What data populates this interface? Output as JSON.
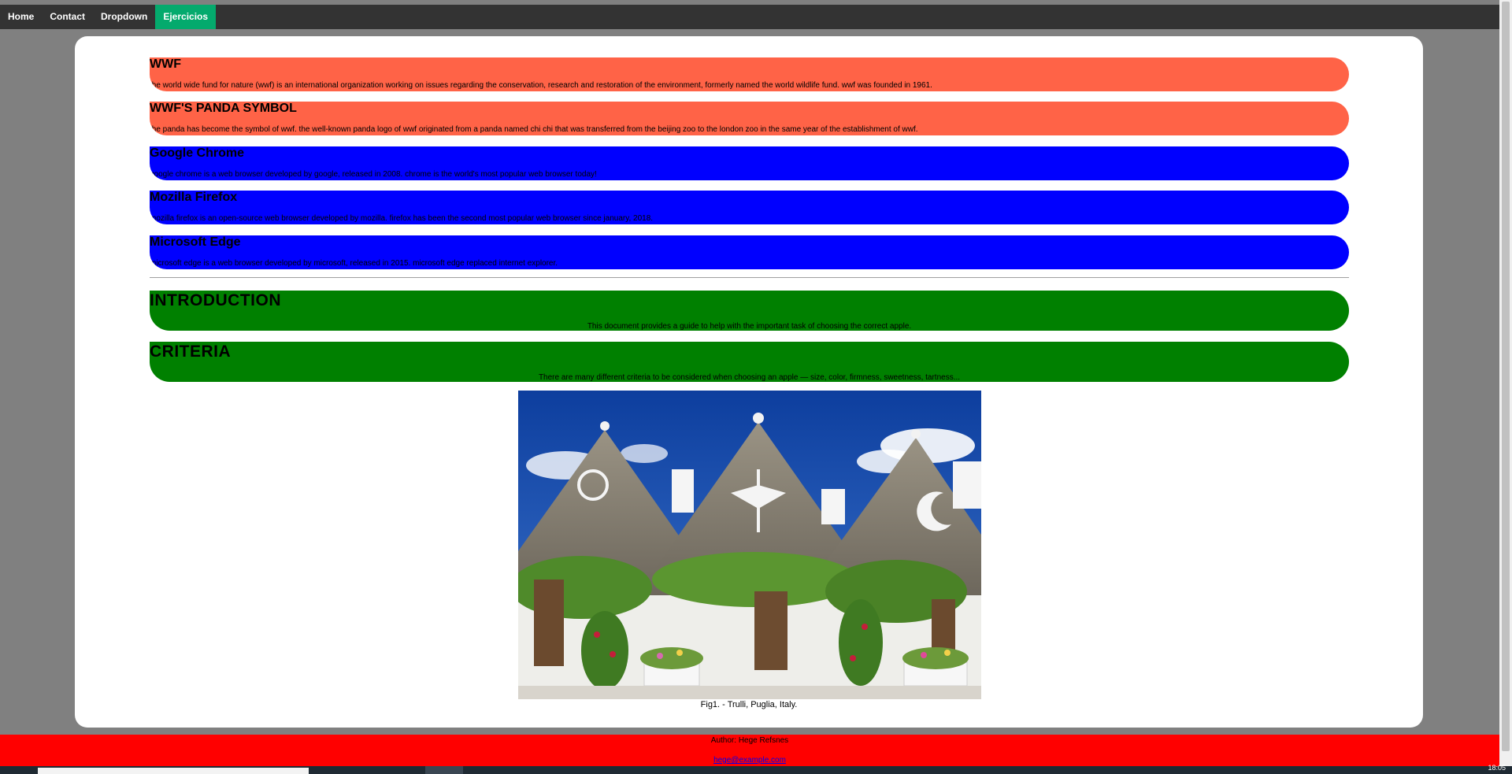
{
  "nav": {
    "items": [
      "Home",
      "Contact",
      "Dropdown",
      "Ejercicios"
    ],
    "active_index": 3,
    "colors": {
      "bar": "#333333",
      "active": "#04aa6d"
    }
  },
  "cards": [
    {
      "title": "WWF",
      "text": "the world wide fund for nature (wwf) is an international organization working on issues regarding the conservation, research and restoration of the environment, formerly named the world wildlife fund. wwf was founded in 1961.",
      "color": "#ff6347"
    },
    {
      "title": "WWF'S PANDA SYMBOL",
      "text": "the panda has become the symbol of wwf. the well-known panda logo of wwf originated from a panda named chi chi that was transferred from the beijing zoo to the london zoo in the same year of the establishment of wwf.",
      "color": "#ff6347"
    },
    {
      "title": "Google Chrome",
      "text": "google chrome is a web browser developed by google, released in 2008. chrome is the world's most popular web browser today!",
      "color": "#0000ff"
    },
    {
      "title": "Mozilla Firefox",
      "text": "mozilla firefox is an open-source web browser developed by mozilla. firefox has been the second most popular web browser since january, 2018.",
      "color": "#0000ff"
    },
    {
      "title": "Microsoft Edge",
      "text": "microsoft edge is a web browser developed by microsoft, released in 2015. microsoft edge replaced internet explorer.",
      "color": "#0000ff"
    }
  ],
  "sections": [
    {
      "title": "INTRODUCTION",
      "text": "This document provides a guide to help with the important task of choosing the correct apple.",
      "color": "#008000"
    },
    {
      "title": "CRITERIA",
      "text": "There are many different criteria to be considered when choosing an apple — size, color, firmness, sweetness, tartness...",
      "color": "#008000"
    }
  ],
  "figure": {
    "caption": "Fig1. - Trulli, Puglia, Italy."
  },
  "footer": {
    "author": "Author: Hege Refsnes",
    "email": "hege@example.com",
    "color": "#ff0000"
  },
  "taskbar": {
    "clock": "18:05"
  }
}
